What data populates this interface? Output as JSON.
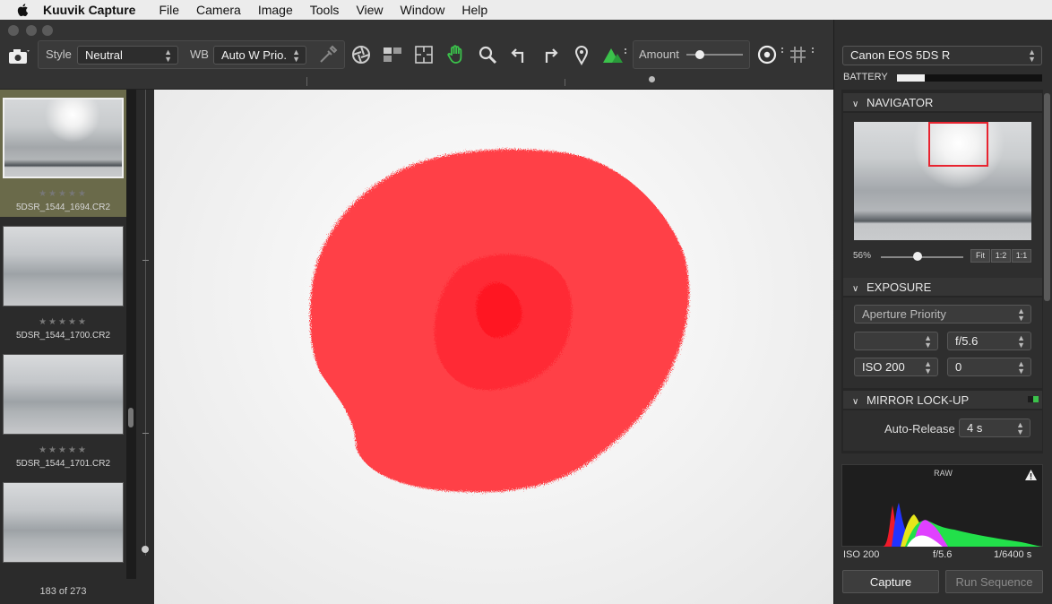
{
  "menubar": {
    "app_name": "Kuuvik Capture",
    "items": [
      "File",
      "Camera",
      "Image",
      "Tools",
      "View",
      "Window",
      "Help"
    ]
  },
  "toolbar": {
    "style_label": "Style",
    "style_value": "Neutral",
    "wb_label": "WB",
    "wb_value": "Auto W Prio.",
    "amount_label": "Amount",
    "amount_level": 0.24
  },
  "filmstrip": {
    "items": [
      {
        "stars": "★★★★★",
        "filename": "5DSR_1544_1694.CR2"
      },
      {
        "stars": "★★★★★",
        "filename": "5DSR_1544_1700.CR2"
      },
      {
        "stars": "★★★★★",
        "filename": "5DSR_1544_1701.CR2"
      }
    ],
    "count": "183 of 273"
  },
  "camera": {
    "model": "Canon EOS 5DS R",
    "battery_label": "BATTERY",
    "battery_level": 0.19
  },
  "navigator": {
    "title": "NAVIGATOR",
    "zoom_text": "56%",
    "zoom_level": 0.45,
    "buttons": [
      "Fit",
      "1:2",
      "1:1"
    ]
  },
  "exposure": {
    "title": "EXPOSURE",
    "mode": "Aperture Priority",
    "shutter": "",
    "aperture": "f/5.6",
    "iso": "ISO 200",
    "compensation": "0"
  },
  "mirror_lockup": {
    "title": "MIRROR LOCK-UP",
    "auto_release_label": "Auto-Release",
    "auto_release_value": "4 s"
  },
  "histogram": {
    "label": "RAW",
    "iso": "ISO 200",
    "aperture": "f/5.6",
    "shutter": "1/6400 s"
  },
  "actions": {
    "capture": "Capture",
    "run_sequence": "Run Sequence"
  },
  "colors": {
    "overexposure": "#ff4046",
    "accent_green": "#3bc24b"
  }
}
